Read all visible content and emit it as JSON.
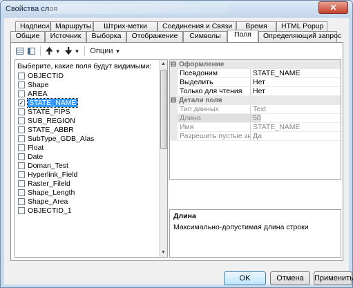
{
  "window": {
    "title": "Свойства слоя",
    "close": "✕"
  },
  "tabs_row1": [
    "Надписи",
    "Маршруты",
    "Штрих-метки",
    "Соединения и Связи",
    "Время",
    "HTML Popup"
  ],
  "tabs_row2": [
    "Общие",
    "Источник",
    "Выборка",
    "Отображение",
    "Символы",
    "Поля",
    "Определяющий запрос"
  ],
  "active_tab": "Поля",
  "toolbar": {
    "options_label": "Опции"
  },
  "fields_panel": {
    "header": "Выберите, какие поля будут видимыми:",
    "fields": [
      {
        "name": "OBJECTID",
        "checked": false
      },
      {
        "name": "Shape",
        "checked": false
      },
      {
        "name": "AREA",
        "checked": false
      },
      {
        "name": "STATE_NAME",
        "checked": true,
        "selected": true
      },
      {
        "name": "STATE_FIPS",
        "checked": false
      },
      {
        "name": "SUB_REGION",
        "checked": false
      },
      {
        "name": "STATE_ABBR",
        "checked": false
      },
      {
        "name": "SubType_GDB_Alas",
        "checked": false
      },
      {
        "name": "Float",
        "checked": false
      },
      {
        "name": "Date",
        "checked": false
      },
      {
        "name": "Doman_Test",
        "checked": false
      },
      {
        "name": "Hyperlink_Field",
        "checked": false
      },
      {
        "name": "Raster_Fileld",
        "checked": false
      },
      {
        "name": "Shape_Length",
        "checked": false
      },
      {
        "name": "Shape_Area",
        "checked": false
      },
      {
        "name": "OBJECTID_1",
        "checked": false
      }
    ]
  },
  "properties": {
    "cat_appearance": "Оформление",
    "appearance_rows": [
      {
        "key": "Псевдоним",
        "value": "STATE_NAME"
      },
      {
        "key": "Выделить",
        "value": "Нет"
      },
      {
        "key": "Только для чтения",
        "value": "Нет"
      }
    ],
    "cat_details": "Детали поля",
    "detail_rows": [
      {
        "key": "Тип данных",
        "value": "Text"
      },
      {
        "key": "Длина",
        "value": "50"
      },
      {
        "key": "Имя",
        "value": "STATE_NAME"
      },
      {
        "key": "Разрешить пустые значе",
        "value": "Да"
      }
    ]
  },
  "description": {
    "title": "Длина",
    "text": "Максимально-допустимая длина строки"
  },
  "buttons": {
    "ok": "OK",
    "cancel": "Отмена",
    "apply": "Применить"
  }
}
